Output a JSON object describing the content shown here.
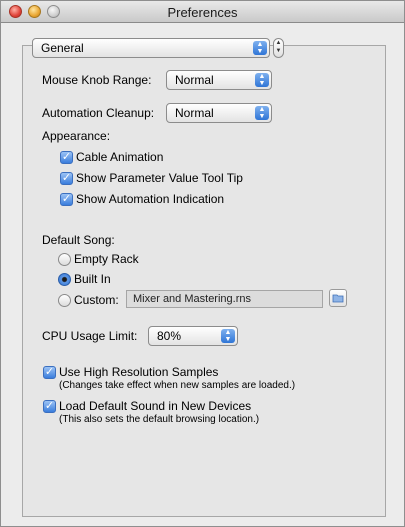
{
  "window": {
    "title": "Preferences"
  },
  "category": {
    "selected": "General"
  },
  "mouse_knob": {
    "label": "Mouse Knob Range:",
    "value": "Normal"
  },
  "automation_cleanup": {
    "label": "Automation Cleanup:",
    "value": "Normal"
  },
  "appearance": {
    "heading": "Appearance:",
    "options": [
      {
        "label": "Cable Animation",
        "checked": true
      },
      {
        "label": "Show Parameter Value Tool Tip",
        "checked": true
      },
      {
        "label": "Show Automation Indication",
        "checked": true
      }
    ]
  },
  "default_song": {
    "heading": "Default Song:",
    "options": [
      {
        "label": "Empty Rack",
        "selected": false
      },
      {
        "label": "Built In",
        "selected": true
      },
      {
        "label": "Custom:",
        "selected": false
      }
    ],
    "custom_file": "Mixer and Mastering.rns"
  },
  "cpu": {
    "label": "CPU Usage Limit:",
    "value": "80%"
  },
  "high_res": {
    "label": "Use High Resolution Samples",
    "note": "(Changes take effect when new samples are loaded.)",
    "checked": true
  },
  "load_default": {
    "label": "Load Default Sound in New Devices",
    "note": "(This also sets the default browsing location.)",
    "checked": true
  },
  "colors": {
    "accent": "#3a7ddc"
  }
}
